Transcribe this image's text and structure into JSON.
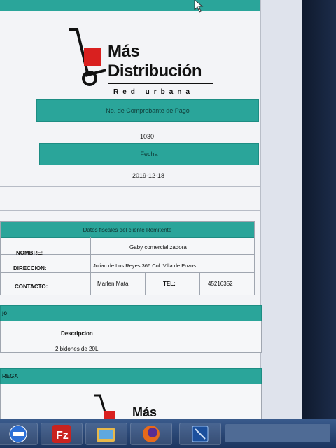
{
  "colors": {
    "teal": "#2aa59a",
    "dark": "#1f2633"
  },
  "logo": {
    "line1": "Más",
    "line2": "Distribución",
    "tagline": "Red urbana",
    "bottom_partial": "Más"
  },
  "receipt": {
    "comprobante_label": "No. de Comprobante de Pago",
    "comprobante_value": "1030",
    "fecha_label": "Fecha",
    "fecha_value": "2019-12-18"
  },
  "client": {
    "title": "Datos fiscales del cliente Remitente",
    "nombre_label": "NOMBRE:",
    "nombre_value": "Gaby comercializadora",
    "direccion_label": "DIRECCION:",
    "direccion_value": "Julian de Los Reyes 366 Col. Villa de Pozos",
    "contacto_label": "CONTACTO:",
    "contacto_value": "Marlen Mata",
    "tel_label": "TEL:",
    "tel_value": "45216352"
  },
  "items": {
    "section_label": "jo",
    "descripcion_header": "Descripcion",
    "descripcion_value": "2 bidones de 20L"
  },
  "entrega": {
    "section_label": "REGA"
  },
  "taskbar": {
    "icons": [
      "no-entry-icon",
      "filezilla-icon",
      "file-manager-icon",
      "firefox-icon",
      "app-window-icon"
    ]
  }
}
